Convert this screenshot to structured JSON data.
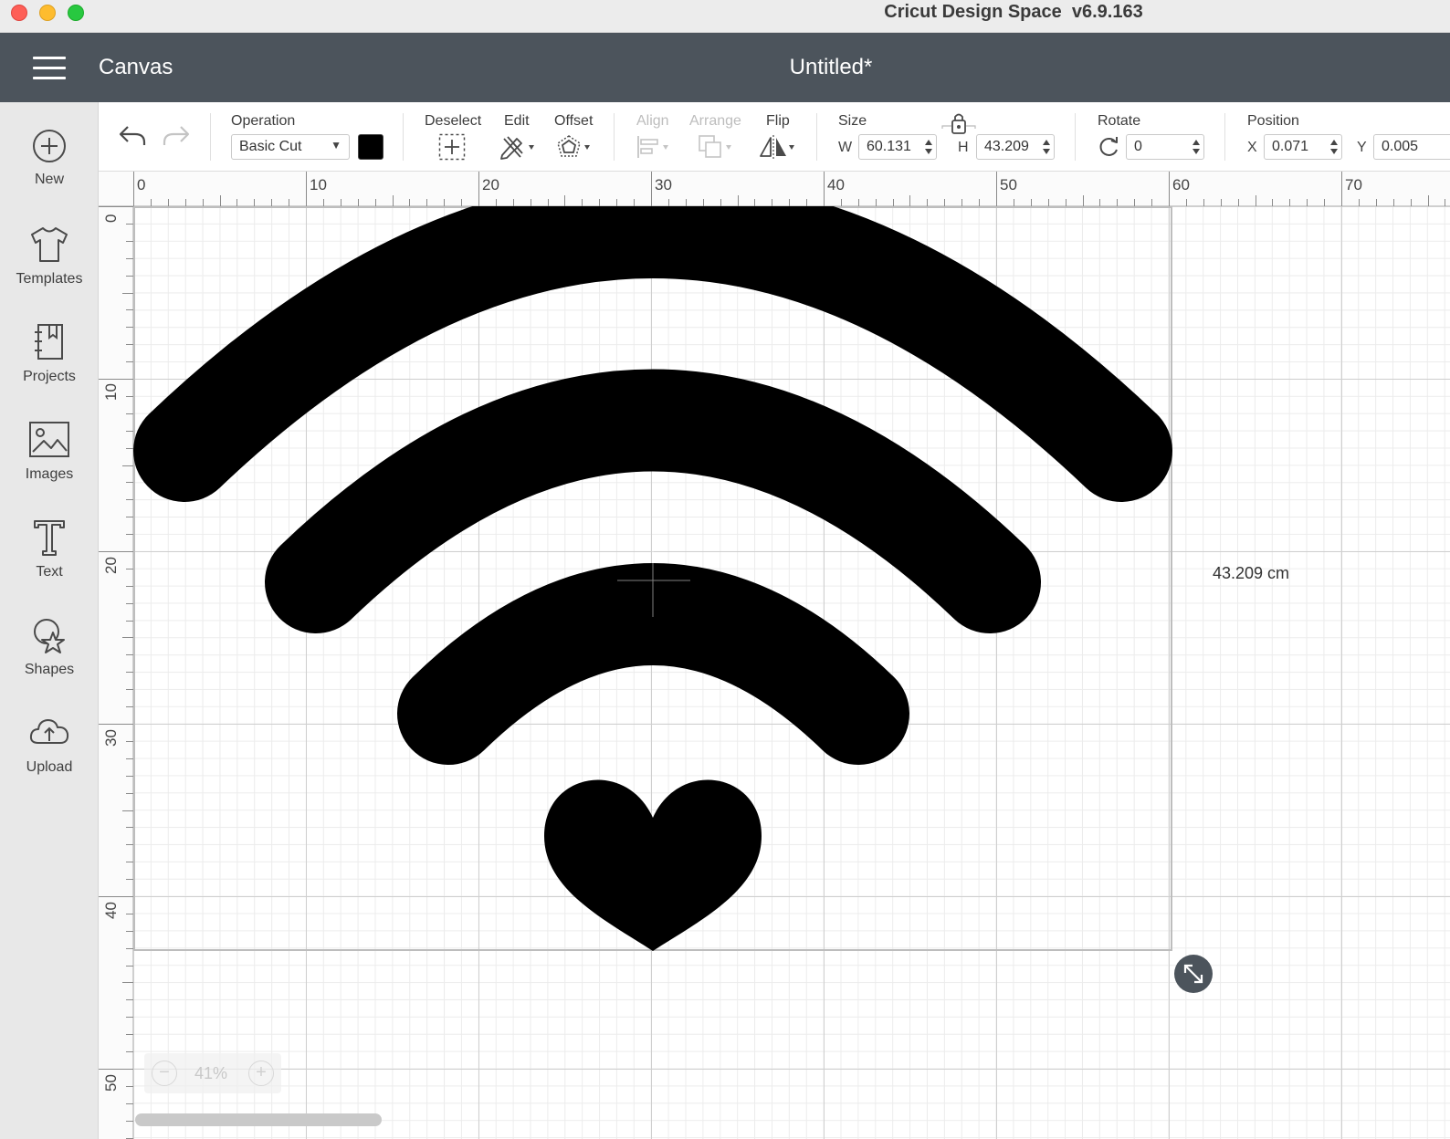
{
  "window": {
    "title": "Cricut Design Space  v6.9.163"
  },
  "header": {
    "section": "Canvas",
    "document_title": "Untitled*"
  },
  "sidebar": {
    "items": [
      {
        "label": "New",
        "icon": "plus-circle-icon"
      },
      {
        "label": "Templates",
        "icon": "tshirt-icon"
      },
      {
        "label": "Projects",
        "icon": "notebook-icon"
      },
      {
        "label": "Images",
        "icon": "image-icon"
      },
      {
        "label": "Text",
        "icon": "text-t-icon"
      },
      {
        "label": "Shapes",
        "icon": "shapes-icon"
      },
      {
        "label": "Upload",
        "icon": "cloud-upload-icon"
      }
    ]
  },
  "toolbar": {
    "operation_label": "Operation",
    "operation_value": "Basic Cut",
    "operation_color": "#000000",
    "deselect_label": "Deselect",
    "edit_label": "Edit",
    "offset_label": "Offset",
    "align_label": "Align",
    "arrange_label": "Arrange",
    "flip_label": "Flip",
    "size_label": "Size",
    "size_w_label": "W",
    "size_w_value": "60.131",
    "size_h_label": "H",
    "size_h_value": "43.209",
    "rotate_label": "Rotate",
    "rotate_value": "0",
    "position_label": "Position",
    "position_x_label": "X",
    "position_x_value": "0.071",
    "position_y_label": "Y",
    "position_y_value": "0.005"
  },
  "ruler": {
    "top": [
      "0",
      "10",
      "20",
      "30",
      "40",
      "50",
      "60",
      "70"
    ],
    "left": [
      "0",
      "10",
      "20",
      "30",
      "40",
      "50"
    ]
  },
  "canvas": {
    "height_readout": "43.209 cm",
    "zoom_level": "41%",
    "design_color": "#000000"
  }
}
